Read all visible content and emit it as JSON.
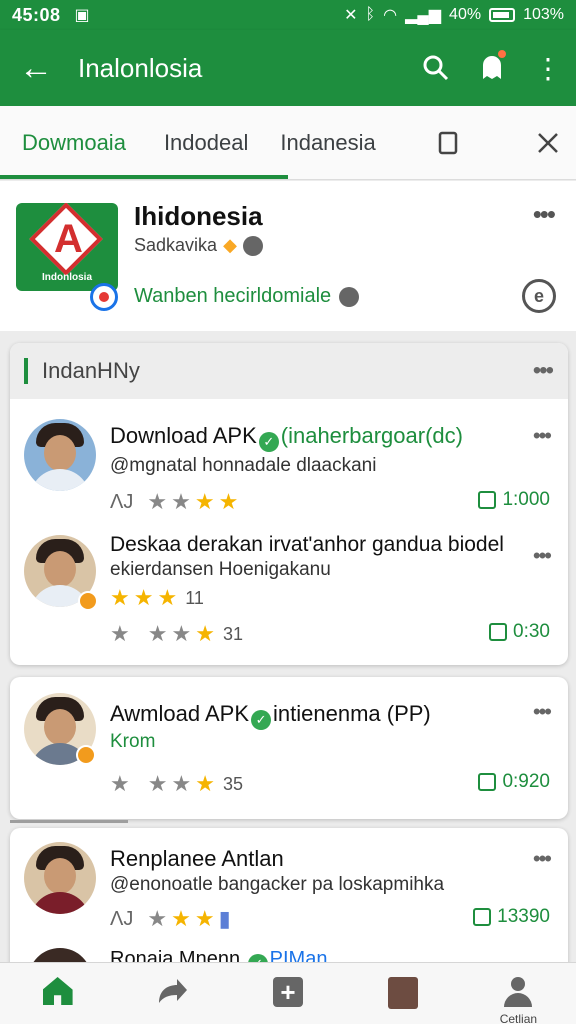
{
  "status_bar": {
    "time": "45:08",
    "left_icon": "image-icon",
    "right_text": "40%",
    "battery_text": "103%"
  },
  "app_bar": {
    "title": "Inalonlosia",
    "back_icon": "arrow-back-icon",
    "actions": [
      "search-icon",
      "notification-icon",
      "more-vert-icon"
    ]
  },
  "tabs": [
    {
      "label": "Dowmoaia",
      "active": true
    },
    {
      "label": "Indodeal",
      "active": false
    },
    {
      "label": "Indanesia",
      "active": false
    }
  ],
  "app": {
    "name": "Ihidonesia",
    "developer": "Sadkavika",
    "icon_label": "Indonlosia",
    "tagline": "Wanben hecirldomiale"
  },
  "section": {
    "title": "IndanHNy"
  },
  "reviews": [
    {
      "name": "Download APK",
      "name_suffix": "(inaherbargoar(dc)",
      "subtitle": "@mgnatal honnadale dlaackani",
      "lead_glyph": "ɅJ",
      "likes": "1:000"
    },
    {
      "name": "Deskaa derakan irvat'anhor gandua biodel",
      "subtitle": "ekierdansen Hoenigakanu",
      "subtitle_rating": "11",
      "rating_value": "31",
      "likes": "0:30"
    }
  ],
  "card2": {
    "name": "Awmload APK",
    "name_suffix": "intienenma (PP)",
    "subtitle": "Krom",
    "rating_value": "35",
    "likes": "0:920"
  },
  "card3": {
    "name": "Renplanee Antlan",
    "subtitle": "@enonoatle bangacker pa loskapmihka",
    "lead_glyph": "ɅJ",
    "likes": "13390",
    "next_name": "Ronaia Mnenn",
    "next_suffix": "PIMan"
  },
  "bottom_nav": [
    {
      "icon": "home-icon",
      "label": ""
    },
    {
      "icon": "forward-icon",
      "label": ""
    },
    {
      "icon": "add-box-icon",
      "label": ""
    },
    {
      "icon": "profile-photo-icon",
      "label": ""
    },
    {
      "icon": "account-icon",
      "label": "Cetlian"
    }
  ],
  "colors": {
    "primary": "#1e8e3e",
    "star": "#f5b400",
    "accent_orange": "#f29b1d"
  }
}
